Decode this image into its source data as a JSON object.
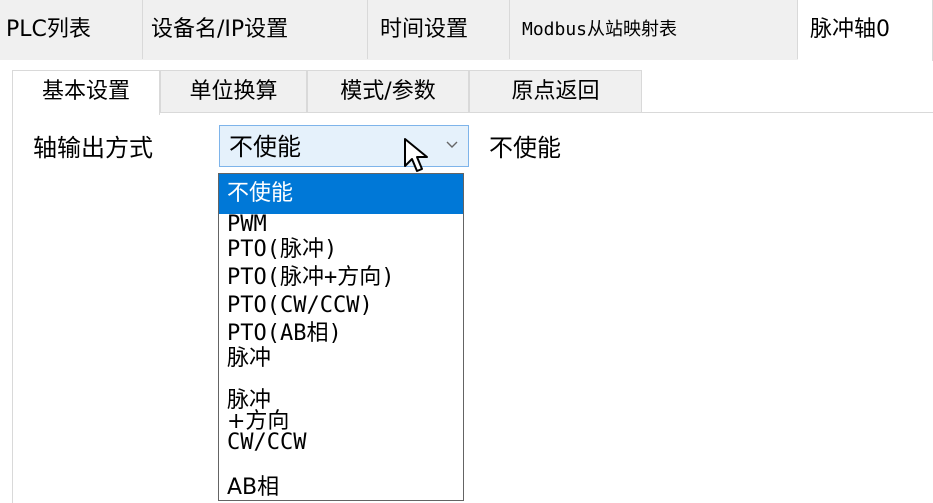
{
  "colors": {
    "tab_bar_background": "#f0f0f0",
    "border": "#d9d9d9",
    "combo_background": "#e5f1fb",
    "combo_border": "#7eb4ea",
    "selected_option_background": "#0078d7",
    "selected_option_text": "#ffffff",
    "dropdown_border": "#646464"
  },
  "top_tabs": [
    {
      "label": "PLC列表",
      "active": false
    },
    {
      "label": "设备名/IP设置",
      "active": false
    },
    {
      "label": "时间设置",
      "active": false
    },
    {
      "label": "Modbus从站映射表",
      "active": false
    },
    {
      "label": "脉冲轴0",
      "active": true
    }
  ],
  "sub_tabs": [
    {
      "label": "基本设置",
      "active": true
    },
    {
      "label": "单位换算",
      "active": false
    },
    {
      "label": "模式/参数",
      "active": false
    },
    {
      "label": "原点返回",
      "active": false
    }
  ],
  "axis_output": {
    "label": "轴输出方式",
    "selected_value": "不使能",
    "status_text": "不使能",
    "arrow_icon": "chevron-down-icon",
    "options": [
      {
        "label": "不使能",
        "selected": true
      },
      {
        "label": "PWM",
        "selected": false
      },
      {
        "label": "PTO(脉冲)",
        "selected": false
      },
      {
        "label": "PTO(脉冲+方向)",
        "selected": false
      },
      {
        "label": "PTO(CW/CCW)",
        "selected": false
      },
      {
        "label": "PTO(AB相)",
        "selected": false
      },
      {
        "label": "脉冲",
        "selected": false
      },
      {
        "label": "脉冲+方向",
        "selected": false
      },
      {
        "label": "CW/CCW",
        "selected": false
      },
      {
        "label": "AB相",
        "selected": false
      }
    ]
  },
  "cursor": {
    "icon": "mouse-pointer-icon"
  }
}
